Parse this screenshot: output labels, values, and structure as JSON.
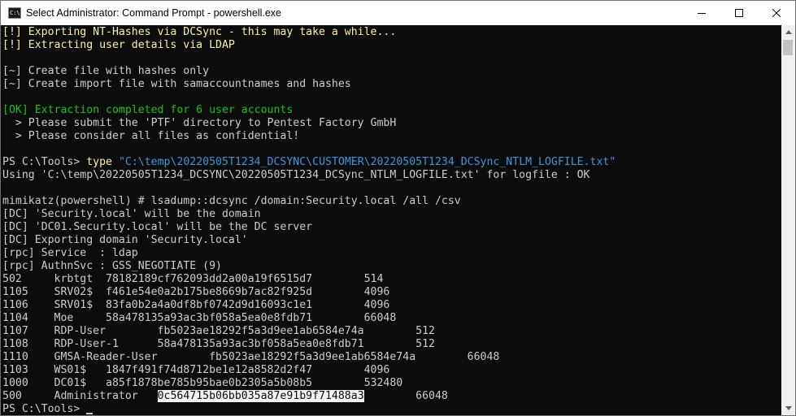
{
  "window": {
    "title": "Select Administrator: Command Prompt - powershell.exe",
    "icon_text": "C:\\"
  },
  "caption": {
    "minimize_icon": "minimize-icon",
    "maximize_icon": "maximize-icon",
    "close_icon": "close-icon"
  },
  "colors": {
    "background": "#0c0c0c",
    "default_text": "#cccccc",
    "yellow": "#f9f1a5",
    "green": "#16c60c",
    "string": "#3a96dd",
    "selection": "#f2f2f2"
  },
  "console": {
    "lines": [
      [
        {
          "t": "[!] Exporting NT-Hashes via DCSync - this may take a while...",
          "c": "yellow"
        }
      ],
      [
        {
          "t": "[!] Extracting user details via LDAP",
          "c": "yellow"
        }
      ],
      [
        {
          "t": "",
          "c": "gray"
        }
      ],
      [
        {
          "t": "[~] Create file with hashes only",
          "c": "gray"
        }
      ],
      [
        {
          "t": "[~] Create import file with samaccountnames and hashes",
          "c": "gray"
        }
      ],
      [
        {
          "t": "",
          "c": "gray"
        }
      ],
      [
        {
          "t": "[OK] Extraction completed for 6 user accounts",
          "c": "green"
        }
      ],
      [
        {
          "t": "  > Please submit the 'PTF' directory to Pentest Factory GmbH",
          "c": "gray"
        }
      ],
      [
        {
          "t": "  > Please consider all files as confidential!",
          "c": "gray"
        }
      ],
      [
        {
          "t": "",
          "c": "gray"
        }
      ],
      [
        {
          "t": "PS C:\\Tools> ",
          "c": "gray"
        },
        {
          "t": "type",
          "c": "yellow"
        },
        {
          "t": " ",
          "c": "gray"
        },
        {
          "t": "\"C:\\temp\\20220505T1234_DCSYNC\\CUSTOMER\\20220505T1234_DCSync_NTLM_LOGFILE.txt\"",
          "c": "string"
        }
      ],
      [
        {
          "t": "Using 'C:\\temp\\20220505T1234_DCSYNC\\20220505T1234_DCSync_NTLM_LOGFILE.txt' for logfile : OK",
          "c": "gray"
        }
      ],
      [
        {
          "t": "",
          "c": "gray"
        }
      ],
      [
        {
          "t": "mimikatz(powershell) # lsadump::dcsync /domain:Security.local /all /csv",
          "c": "gray"
        }
      ],
      [
        {
          "t": "[DC] 'Security.local' will be the domain",
          "c": "gray"
        }
      ],
      [
        {
          "t": "[DC] 'DC01.Security.local' will be the DC server",
          "c": "gray"
        }
      ],
      [
        {
          "t": "[DC] Exporting domain 'Security.local'",
          "c": "gray"
        }
      ],
      [
        {
          "t": "[rpc] Service  : ldap",
          "c": "gray"
        }
      ],
      [
        {
          "t": "[rpc] AuthnSvc : GSS_NEGOTIATE (9)",
          "c": "gray"
        }
      ],
      [
        {
          "t": "502     krbtgt  78182189cf762093dd2a00a19f6515d7        514",
          "c": "gray"
        }
      ],
      [
        {
          "t": "1105    SRV02$  f461e54e0a2b175be8669b7ac82f925d        4096",
          "c": "gray"
        }
      ],
      [
        {
          "t": "1106    SRV01$  83fa0b2a4a0df8bf0742d9d16093c1e1        4096",
          "c": "gray"
        }
      ],
      [
        {
          "t": "1104    Moe     58a478135a93ac3bf058a5ea0e8fdb71        66048",
          "c": "gray"
        }
      ],
      [
        {
          "t": "1107    RDP-User        fb5023ae18292f5a3d9ee1ab6584e74a        512",
          "c": "gray"
        }
      ],
      [
        {
          "t": "1108    RDP-User-1      58a478135a93ac3bf058a5ea0e8fdb71        512",
          "c": "gray"
        }
      ],
      [
        {
          "t": "1110    GMSA-Reader-User        fb5023ae18292f5a3d9ee1ab6584e74a        66048",
          "c": "gray"
        }
      ],
      [
        {
          "t": "1103    WS01$   1847f491f74d8712be1e12a8582d2f47        4096",
          "c": "gray"
        }
      ],
      [
        {
          "t": "1000    DC01$   a85f1878be785b95bae0b2305a5b08b5        532480",
          "c": "gray"
        }
      ],
      [
        {
          "t": "500     Administrator   ",
          "c": "gray"
        },
        {
          "t": "0c564715b06bb035a87e91b9f71488a3",
          "c": "selected"
        },
        {
          "t": "        66048",
          "c": "gray"
        }
      ],
      [
        {
          "t": "PS C:\\Tools> ",
          "c": "gray"
        },
        {
          "t": "",
          "c": "cursor"
        }
      ]
    ]
  },
  "scrollbar": {
    "up_icon": "scroll-up-arrow-icon",
    "down_icon": "scroll-down-arrow-icon"
  }
}
